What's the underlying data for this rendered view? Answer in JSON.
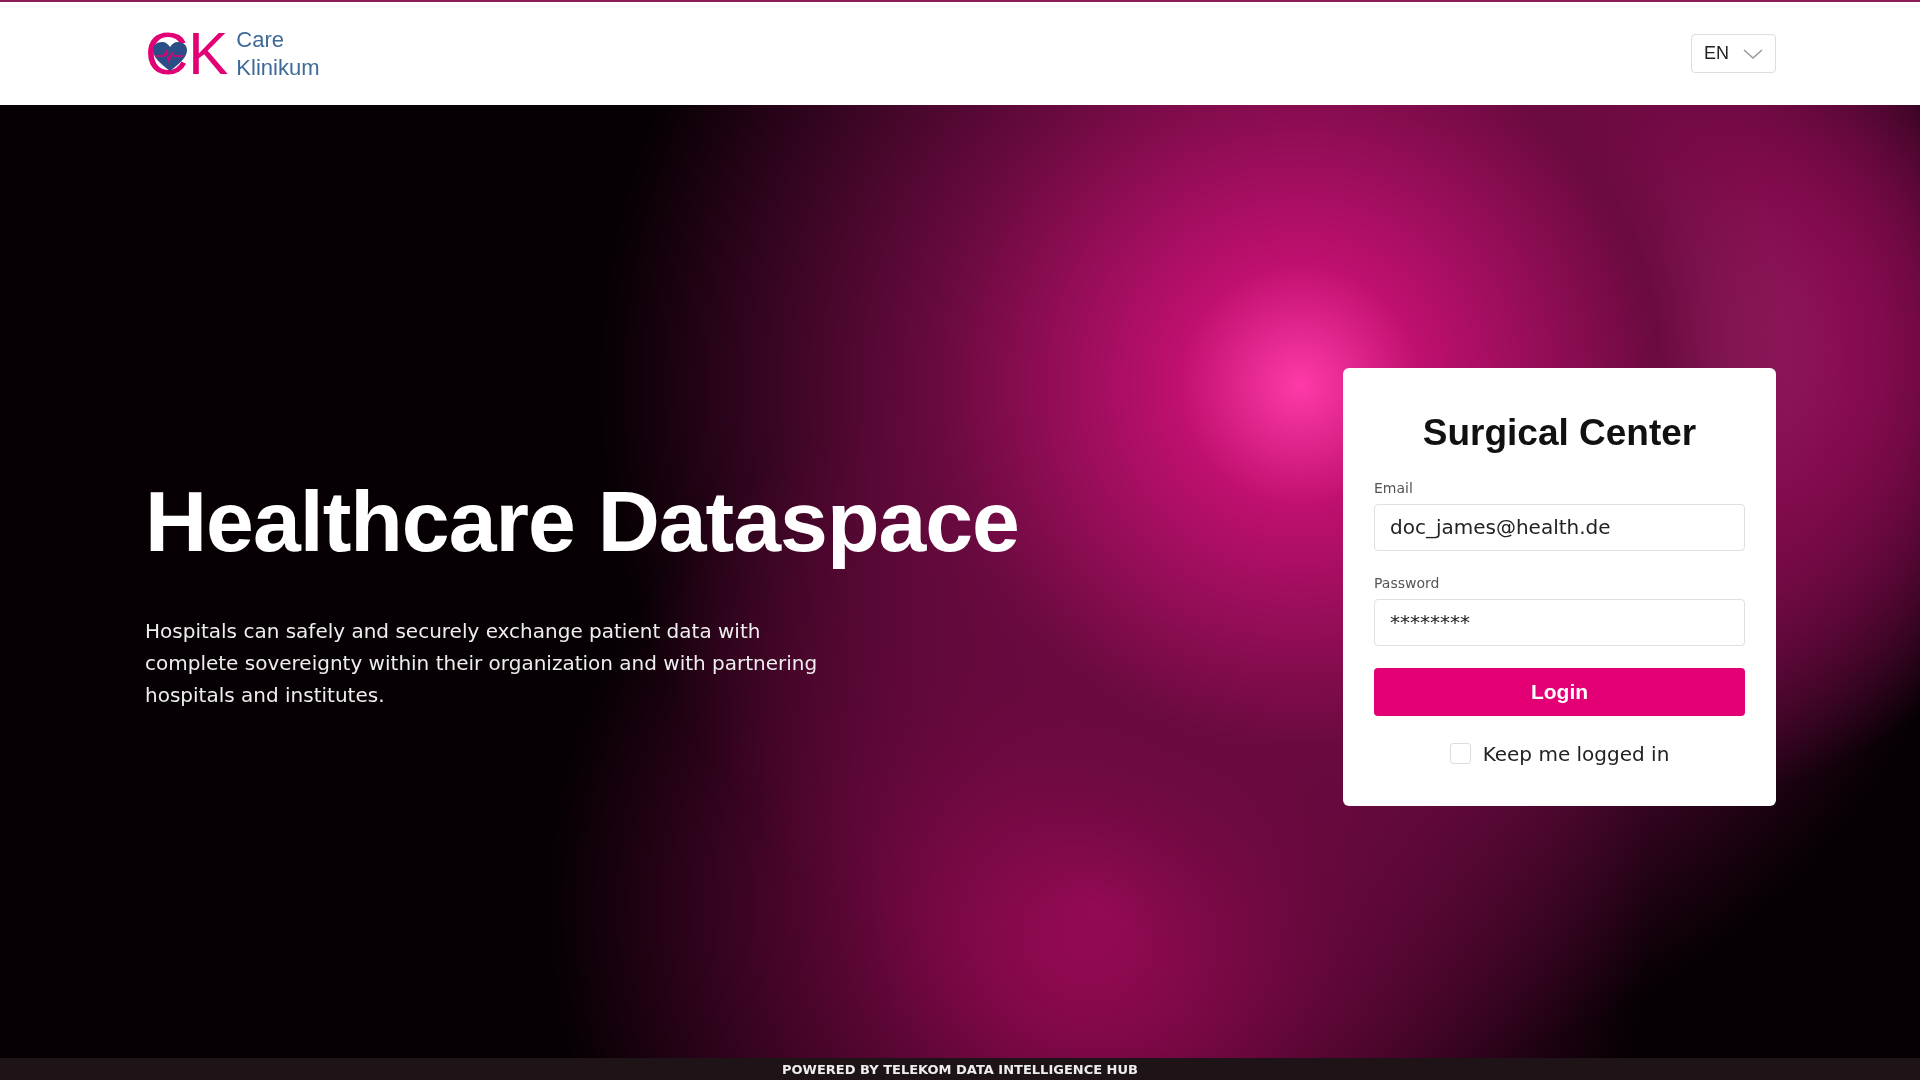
{
  "header": {
    "logo": {
      "mark": "CK",
      "line_1": "Care",
      "line_2": "Klinikum"
    },
    "language": {
      "value": "EN"
    }
  },
  "hero": {
    "title": "Healthcare Dataspace",
    "description": "Hospitals can safely and securely exchange patient data with complete sovereignty within  their organization and with partnering hospitals and institutes."
  },
  "login": {
    "title": "Surgical Center",
    "fields": [
      {
        "label": "Email",
        "value": "doc_james@health.de"
      },
      {
        "label": "Password",
        "value": "********"
      }
    ],
    "button": "Login",
    "remember": {
      "label": "Keep me logged in",
      "checked": false
    }
  },
  "footer": {
    "text": "POWERED BY TELEKOM DATA INTELLIGENCE HUB"
  }
}
